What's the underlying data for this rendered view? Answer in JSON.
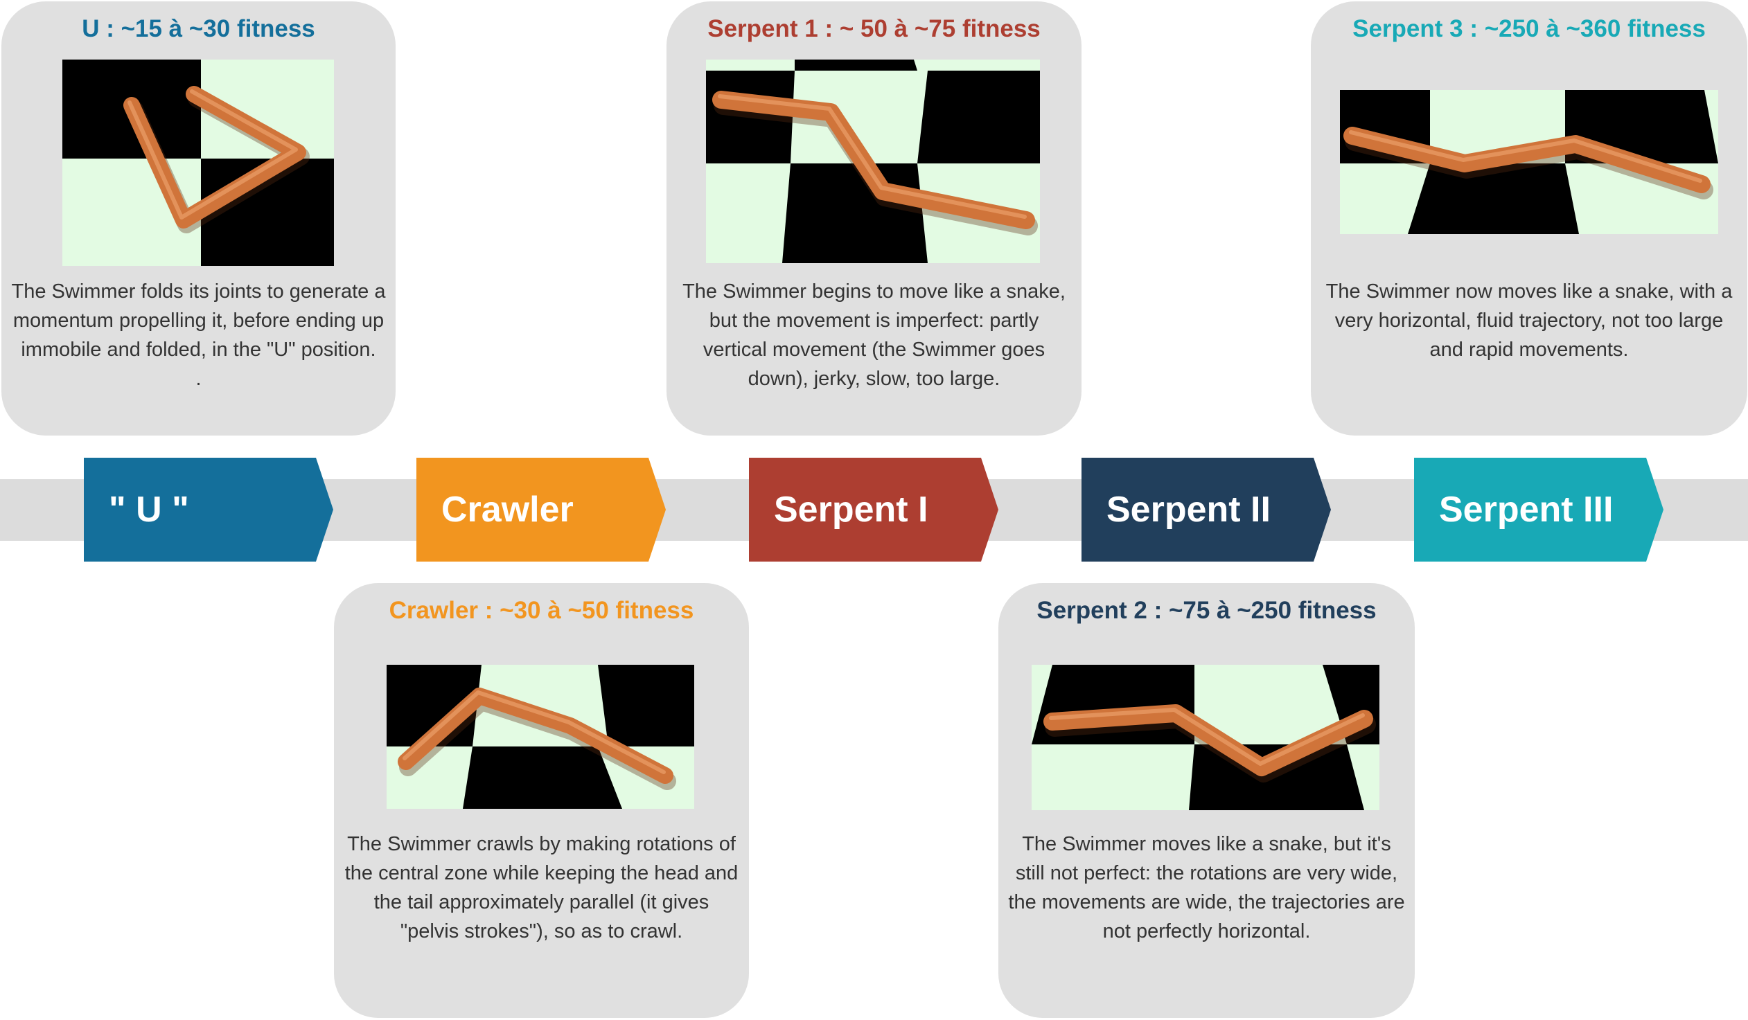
{
  "colors": {
    "u": "#146f9b",
    "crawler": "#f2951f",
    "serpent1": "#ad3e31",
    "serpent2": "#213f5c",
    "serpent3": "#18a9b6",
    "card_bg": "#e0e0e0",
    "band": "#dcdcdc",
    "swimmer": "#d0743a",
    "floor_light": "#e3fbe3",
    "floor_dark": "#000000"
  },
  "stages": [
    {
      "label": "\" U \""
    },
    {
      "label": "Crawler"
    },
    {
      "label": "Serpent I"
    },
    {
      "label": "Serpent II"
    },
    {
      "label": "Serpent III"
    }
  ],
  "cards": {
    "u": {
      "title": "U : ~15 à ~30 fitness",
      "description": "The Swimmer folds its joints to generate a\nmomentum propelling it, before ending up\nimmobile and folded, in the \"U\" position.\n."
    },
    "crawler": {
      "title": "Crawler : ~30 à ~50 fitness",
      "description": "The Swimmer crawls by making rotations of\nthe central zone while keeping the head and\nthe tail approximately parallel (it gives\n\"pelvis strokes\"), so as to crawl."
    },
    "serpent1": {
      "title": "Serpent 1 : ~ 50 à ~75 fitness",
      "description": "The Swimmer begins to move like a snake,\nbut the movement is imperfect: partly\nvertical movement (the Swimmer goes\ndown), jerky, slow, too large."
    },
    "serpent2": {
      "title": "Serpent 2 : ~75 à ~250 fitness",
      "description": "The Swimmer moves like a snake, but it's\nstill not perfect: the rotations are very wide,\nthe movements are wide, the trajectories are\nnot perfectly horizontal."
    },
    "serpent3": {
      "title": "Serpent 3 : ~250 à ~360 fitness",
      "description": "The Swimmer now moves like a snake, with a\nvery horizontal, fluid trajectory, not too large\nand rapid movements."
    }
  }
}
